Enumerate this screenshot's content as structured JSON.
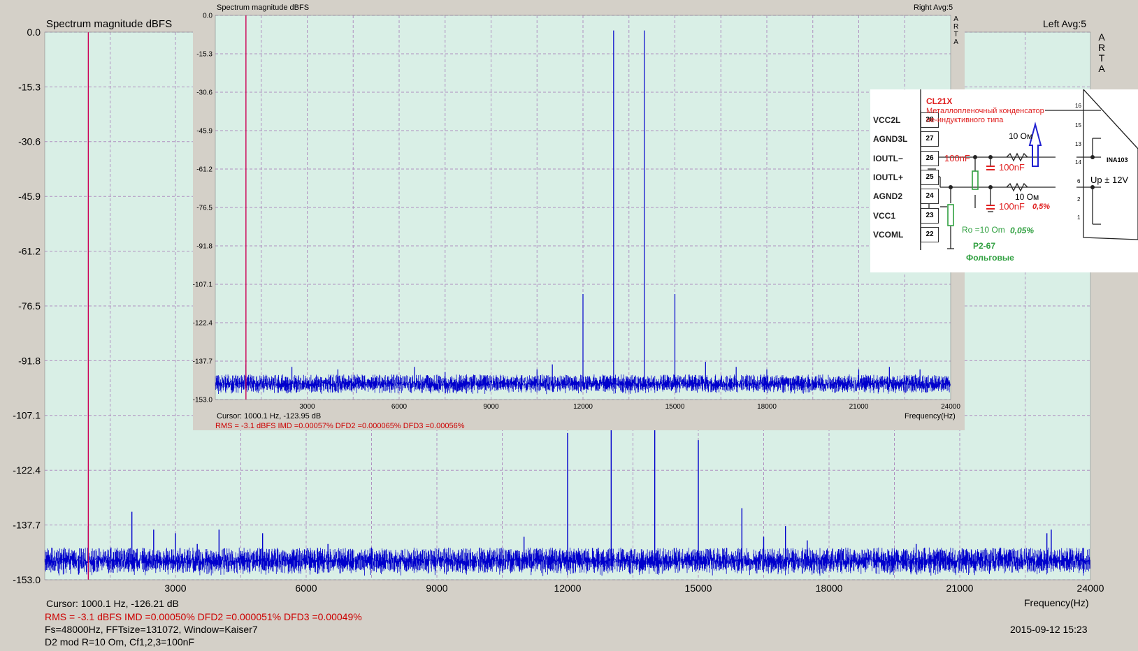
{
  "main": {
    "title": "Spectrum magnitude dBFS",
    "channel": "Left  Avg:5",
    "arta": [
      "A",
      "R",
      "T",
      "A"
    ],
    "cursor": "Cursor:  1000.1 Hz, -126.21 dB",
    "rms": "RMS =   -3.1 dBFS   IMD =0.00050%  DFD2 =0.000051%  DFD3 =0.00049%",
    "fft": "Fs=48000Hz, FFTsize=131072, Window=Kaiser7",
    "note": "D2 mod R=10 Om, Cf1,2,3=100nF",
    "date": "2015-09-12  15:23",
    "freq_label": "Frequency(Hz)"
  },
  "inset": {
    "title": "Spectrum magnitude dBFS",
    "channel": "Right  Avg:5",
    "arta": [
      "A",
      "R",
      "T",
      "A"
    ],
    "cursor": "Cursor:  1000.1 Hz, -123.95 dB",
    "rms": "RMS =   -3.1 dBFS   IMD =0.00057%  DFD2 =0.000065%  DFD3 =0.00056%",
    "freq_label": "Frequency(Hz)"
  },
  "chart_data": [
    {
      "type": "line",
      "title": "Spectrum magnitude dBFS",
      "xlabel": "Frequency(Hz)",
      "ylabel": "",
      "xlim": [
        0,
        24000
      ],
      "ylim": [
        -153.0,
        0.0
      ],
      "yticks": [
        "0.0",
        "-15.3",
        "-30.6",
        "-45.9",
        "-61.2",
        "-76.5",
        "-91.8",
        "-107.1",
        "-122.4",
        "-137.7",
        "-153.0"
      ],
      "xticks": [
        "3000",
        "6000",
        "9000",
        "12000",
        "15000",
        "18000",
        "21000",
        "24000"
      ],
      "cursor_hz": 1000.1,
      "noise_floor_db": [
        -150,
        -144
      ],
      "peaks": [
        {
          "x": 1000,
          "y": -138
        },
        {
          "x": 1520,
          "y": -144
        },
        {
          "x": 2000,
          "y": -134
        },
        {
          "x": 2500,
          "y": -139
        },
        {
          "x": 3000,
          "y": -140
        },
        {
          "x": 3500,
          "y": -143
        },
        {
          "x": 4000,
          "y": -139
        },
        {
          "x": 4500,
          "y": -145
        },
        {
          "x": 5000,
          "y": -140
        },
        {
          "x": 6500,
          "y": -143
        },
        {
          "x": 7500,
          "y": -144
        },
        {
          "x": 11000,
          "y": -141
        },
        {
          "x": 12000,
          "y": -112
        },
        {
          "x": 13000,
          "y": -69
        },
        {
          "x": 14000,
          "y": -68
        },
        {
          "x": 15000,
          "y": -114
        },
        {
          "x": 16000,
          "y": -133
        },
        {
          "x": 16500,
          "y": -141
        },
        {
          "x": 17000,
          "y": -138
        },
        {
          "x": 17500,
          "y": -142
        },
        {
          "x": 20000,
          "y": -143
        },
        {
          "x": 23000,
          "y": -140
        },
        {
          "x": 23100,
          "y": -139
        }
      ]
    },
    {
      "type": "line",
      "title": "Spectrum magnitude dBFS",
      "xlabel": "Frequency(Hz)",
      "ylabel": "",
      "xlim": [
        0,
        24000
      ],
      "ylim": [
        -153.0,
        0.0
      ],
      "yticks": [
        "0.0",
        "-15.3",
        "-30.6",
        "-45.9",
        "-61.2",
        "-76.5",
        "-91.8",
        "-107.1",
        "-122.4",
        "-137.7",
        "-153.0"
      ],
      "xticks": [
        "3000",
        "6000",
        "9000",
        "12000",
        "15000",
        "18000",
        "21000",
        "24000"
      ],
      "cursor_hz": 1000.1,
      "noise_floor_db": [
        -149,
        -143
      ],
      "peaks": [
        {
          "x": 1000,
          "y": -139
        },
        {
          "x": 2500,
          "y": -140
        },
        {
          "x": 4000,
          "y": -141
        },
        {
          "x": 6500,
          "y": -140
        },
        {
          "x": 7500,
          "y": -142
        },
        {
          "x": 10500,
          "y": -141
        },
        {
          "x": 11000,
          "y": -139
        },
        {
          "x": 12000,
          "y": -111
        },
        {
          "x": 13000,
          "y": -6
        },
        {
          "x": 14000,
          "y": -6
        },
        {
          "x": 15000,
          "y": -111
        },
        {
          "x": 16000,
          "y": -138
        },
        {
          "x": 17000,
          "y": -140
        },
        {
          "x": 18000,
          "y": -141
        },
        {
          "x": 21000,
          "y": -141
        },
        {
          "x": 22000,
          "y": -140
        },
        {
          "x": 23000,
          "y": -141
        }
      ]
    }
  ],
  "schematic": {
    "chip_label": "CL21X",
    "desc1": "Металлопленочный конденсатор",
    "desc2": "не-индуктивного типа",
    "pins": [
      {
        "name": "VCC2L",
        "num": "28"
      },
      {
        "name": "AGND3L",
        "num": "27"
      },
      {
        "name": "IOUTL−",
        "num": "26"
      },
      {
        "name": "IOUTL+",
        "num": "25"
      },
      {
        "name": "AGND2",
        "num": "24"
      },
      {
        "name": "VCC1",
        "num": "23"
      },
      {
        "name": "VCOML",
        "num": "22"
      }
    ],
    "cap1": "100nF",
    "cap2": "100nF",
    "cap3": "100nF",
    "cap3_tol": "0,5%",
    "res1": "10 Ом",
    "res2": "10 Ом",
    "ro": "Ro =10 Om",
    "ro_tol": "0,05%",
    "res_type": "P2-67",
    "res_kind": "Фольговые",
    "amp_name": "INA103",
    "amp_supply": "Up ± 12V",
    "amp_pins": [
      "16",
      "15",
      "13",
      "14",
      "6",
      "2",
      "1"
    ]
  },
  "colors": {
    "plot_bg": "#d9efe6",
    "trace": "#0000cc",
    "cursor": "#cc0055",
    "grid": "#b090c0",
    "text_red": "#cc0000"
  }
}
